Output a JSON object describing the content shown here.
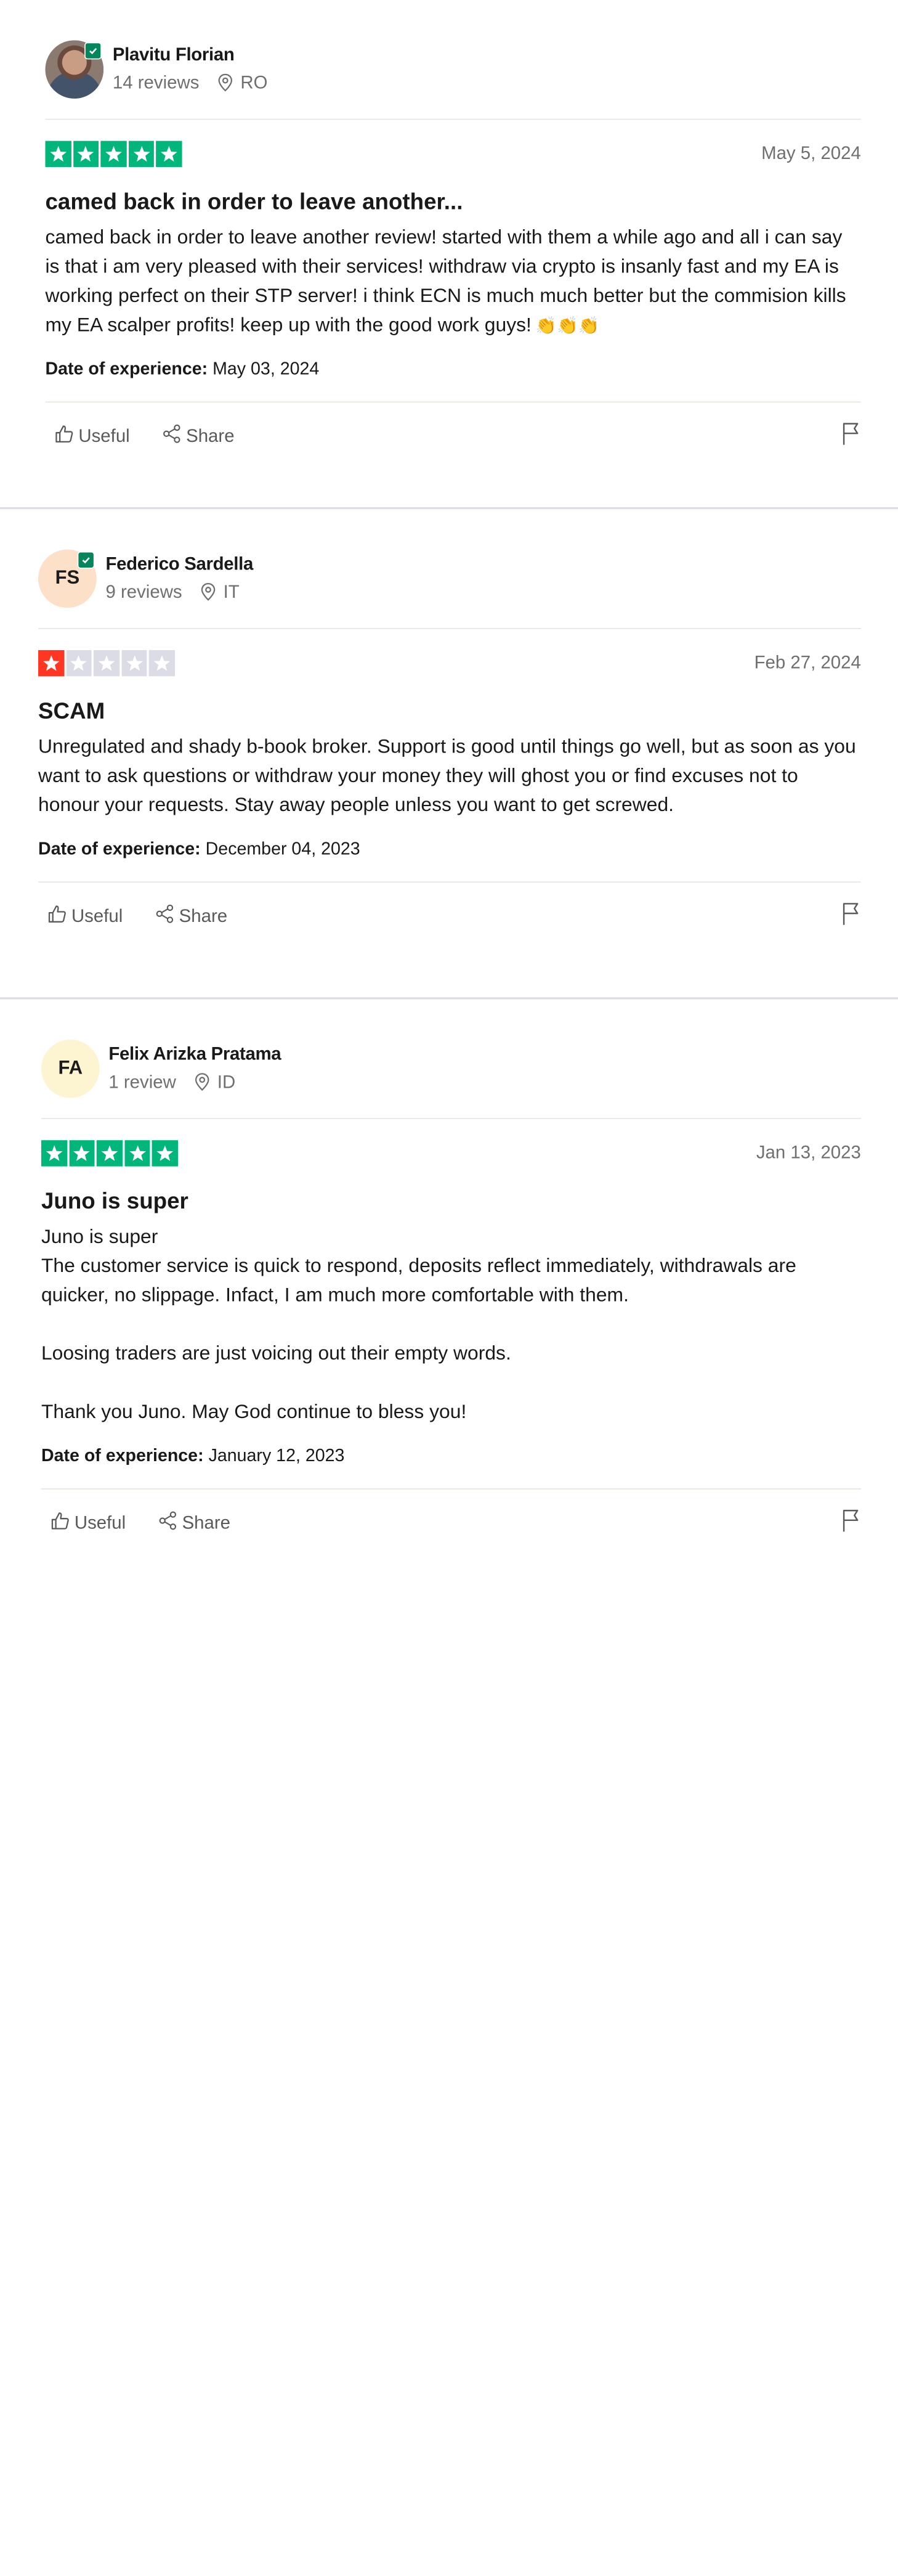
{
  "colors": {
    "star_green": "#00b67a",
    "star_red": "#ff3722",
    "star_empty": "#dcdce6",
    "verified": "#04865c"
  },
  "actions": {
    "useful_label": "Useful",
    "share_label": "Share"
  },
  "doe_label": "Date of experience:",
  "reviews": [
    {
      "name": "Plavitu Florian",
      "initials": "",
      "avatar": "photo",
      "verified": true,
      "review_count": "14 reviews",
      "country": "RO",
      "rating": 5,
      "date": "May 5, 2024",
      "title": "camed back in order to leave another...",
      "body": [
        "camed back in order to leave another review! started with them a while ago and all i can say is that i am very pleased with their services! withdraw via crypto is insanly fast and my EA is working perfect on their STP server! i think ECN is much much better but the commision kills my EA scalper profits! keep up with the good work guys!"
      ],
      "body_emoji": "👏👏👏",
      "date_of_experience": "May 03, 2024"
    },
    {
      "name": "Federico Sardella",
      "initials": "FS",
      "avatar": "peach",
      "verified": true,
      "review_count": "9 reviews",
      "country": "IT",
      "rating": 1,
      "date": "Feb 27, 2024",
      "title": "SCAM",
      "body": [
        "Unregulated and shady b-book broker. Support is good until things go well, but as soon as you want to ask questions or withdraw your money they will ghost you or find excuses not to honour your requests. Stay away people unless you want to get screwed."
      ],
      "date_of_experience": "December 04, 2023"
    },
    {
      "name": "Felix Arizka Pratama",
      "initials": "FA",
      "avatar": "yellow",
      "verified": false,
      "review_count": "1 review",
      "country": "ID",
      "rating": 5,
      "date": "Jan 13, 2023",
      "title": "Juno is super",
      "body": [
        "Juno is super",
        "The customer service is quick to respond, deposits reflect immediately, withdrawals are quicker, no slippage. Infact, I am much more comfortable with them.",
        "Loosing traders are just voicing out their empty words.",
        "Thank you Juno. May God continue to bless you!"
      ],
      "date_of_experience": "January 12, 2023"
    }
  ]
}
